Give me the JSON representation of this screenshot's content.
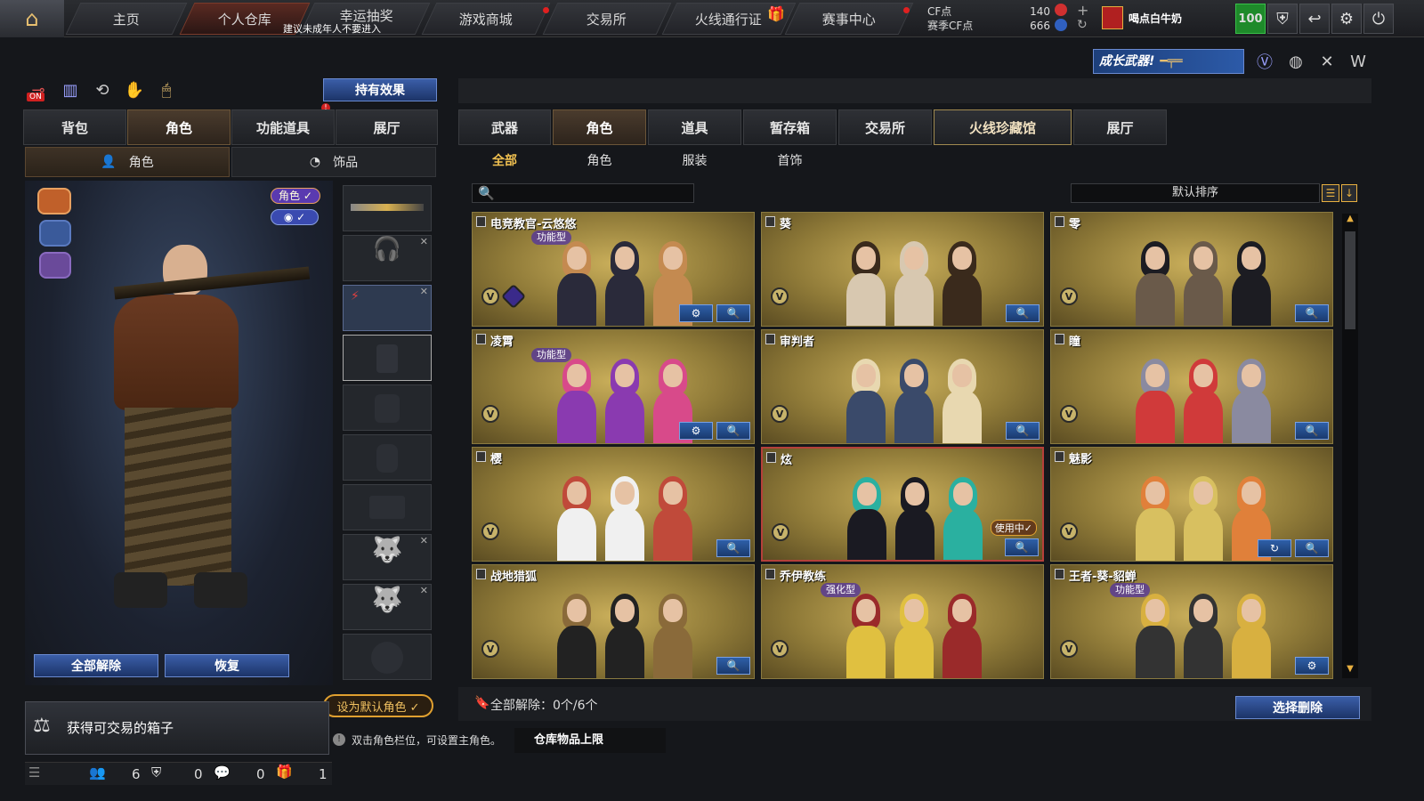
{
  "nav": {
    "tabs": [
      "主页",
      "个人仓库",
      "幸运抽奖",
      "游戏商城",
      "交易所",
      "火线通行证",
      "赛事中心"
    ],
    "warning": "建议未成年人不要进入",
    "cf_label": "CF点",
    "season_cf_label": "赛季CF点",
    "cf_value": "140",
    "season_cf_value": "666",
    "username": "喝点白牛奶",
    "level": "100"
  },
  "banner": {
    "text": "成长武器!"
  },
  "left": {
    "effects_button": "持有效果",
    "tabs": [
      "背包",
      "角色",
      "功能道具",
      "展厅"
    ],
    "subtabs": [
      "角色",
      "饰品"
    ],
    "role_badge": "角色 ✓",
    "unequip_all": "全部解除",
    "restore": "恢复",
    "set_default": "设为默认角色 ✓",
    "toggle_on": "ON"
  },
  "right": {
    "tabs": [
      "武器",
      "角色",
      "道具",
      "暂存箱",
      "交易所",
      "火线珍藏馆",
      "展厅"
    ],
    "subtabs": [
      "全部",
      "角色",
      "服装",
      "首饰"
    ],
    "search_placeholder": "",
    "sort_label": "默认排序",
    "footer_unequip": "全部解除：0个/6个",
    "select_delete": "选择删除"
  },
  "cards": [
    {
      "name": "电竞教官-云悠悠",
      "tag": "功能型",
      "buttons": [
        "⚙",
        "🔍"
      ]
    },
    {
      "name": "葵",
      "tag": "",
      "buttons": [
        "🔍"
      ]
    },
    {
      "name": "零",
      "tag": "",
      "buttons": [
        "🔍"
      ]
    },
    {
      "name": "凌霄",
      "tag": "功能型",
      "buttons": [
        "⚙",
        "🔍"
      ]
    },
    {
      "name": "审判者",
      "tag": "",
      "buttons": [
        "🔍"
      ]
    },
    {
      "name": "瞳",
      "tag": "",
      "buttons": [
        "🔍"
      ]
    },
    {
      "name": "樱",
      "tag": "",
      "buttons": [
        "🔍"
      ]
    },
    {
      "name": "炫",
      "tag": "",
      "buttons": [
        "🔍"
      ],
      "in_use": "使用中✓"
    },
    {
      "name": "魅影",
      "tag": "",
      "buttons": [
        "↻",
        "🔍"
      ]
    },
    {
      "name": "战地猎狐",
      "tag": "",
      "buttons": [
        "🔍"
      ]
    },
    {
      "name": "乔伊教练",
      "tag": "强化型",
      "buttons": []
    },
    {
      "name": "王者-葵-貂蝉",
      "tag": "功能型",
      "buttons": [
        "⚙"
      ]
    }
  ],
  "notice": {
    "title": "获得可交易的箱子",
    "hint": "双击角色栏位，可设置主角色。",
    "storage": "仓库物品上限"
  },
  "bottombar": {
    "count1": "6",
    "count2": "0",
    "count3": "0",
    "count4": "1"
  },
  "colors": {
    "accent": "#c9ae5a",
    "button_blue": "#2e5fa8",
    "selected_border": "#b5403a"
  }
}
